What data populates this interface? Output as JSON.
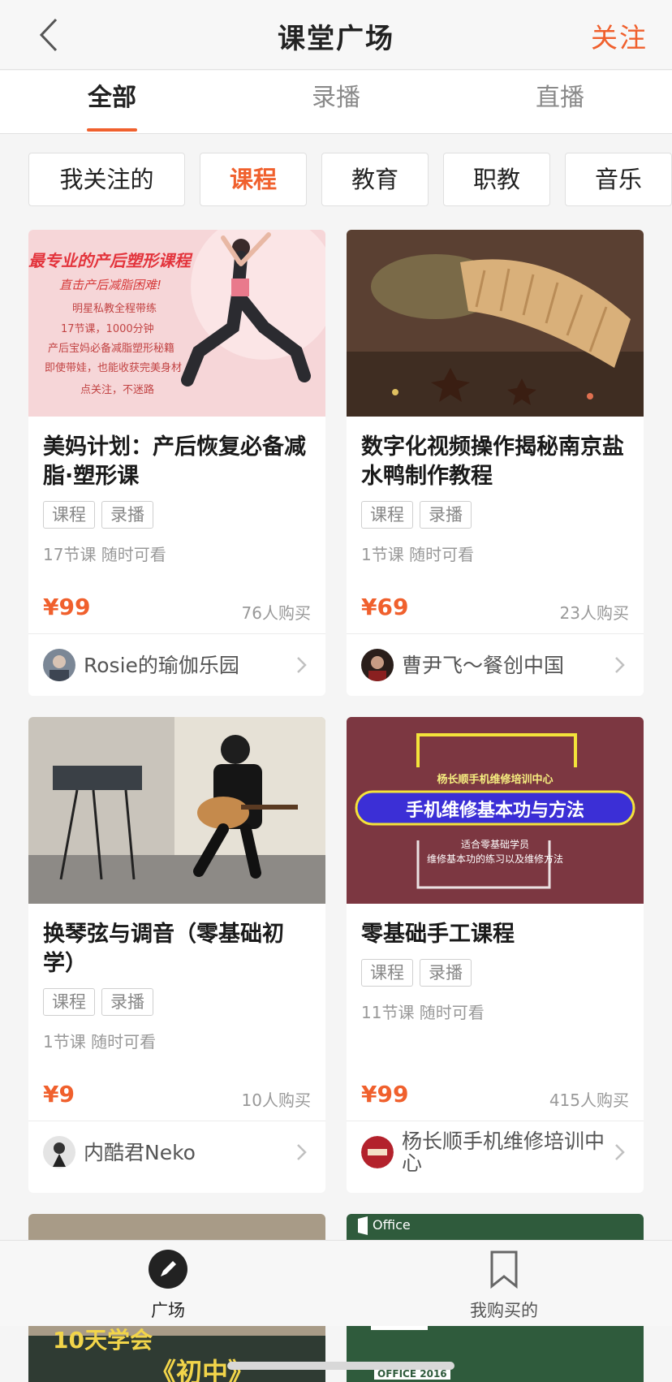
{
  "header": {
    "title": "课堂广场",
    "follow_label": "关注"
  },
  "tabs": [
    {
      "label": "全部",
      "active": true
    },
    {
      "label": "录播",
      "active": false
    },
    {
      "label": "直播",
      "active": false
    }
  ],
  "chips": [
    {
      "label": "我关注的",
      "active": false
    },
    {
      "label": "课程",
      "active": true
    },
    {
      "label": "教育",
      "active": false
    },
    {
      "label": "职教",
      "active": false
    },
    {
      "label": "音乐",
      "active": false
    }
  ],
  "courses": [
    {
      "thumb_lines": [
        "最专业的产后塑形课程",
        "直击产后减脂困难!",
        "明星私教全程带练",
        "17节课，1000分钟",
        "产后宝妈必备减脂塑形秘籍",
        "即使带娃，也能收获完美身材",
        "点关注，不迷路"
      ],
      "title": "美妈计划：产后恢复必备减脂·塑形课",
      "tags": [
        "课程",
        "录播"
      ],
      "meta": "17节课  随时可看",
      "price": "¥99",
      "buyers": "76人购买",
      "author": "Rosie的瑜伽乐园"
    },
    {
      "thumb_lines": [],
      "title": "数字化视频操作揭秘南京盐水鸭制作教程",
      "tags": [
        "课程",
        "录播"
      ],
      "meta": "1节课  随时可看",
      "price": "¥69",
      "buyers": "23人购买",
      "author": "曹尹飞～餐创中国"
    },
    {
      "thumb_lines": [],
      "title": "换琴弦与调音（零基础初学）",
      "tags": [
        "课程",
        "录播"
      ],
      "meta": "1节课  随时可看",
      "price": "¥9",
      "buyers": "10人购买",
      "author": "内酷君Neko"
    },
    {
      "thumb_lines": [
        "杨长顺手机维修培训中心",
        "手机维修基本功与方法",
        "适合零基础学员",
        "维修基本功的练习以及维修方法"
      ],
      "title": "零基础手工课程",
      "tags": [
        "课程",
        "录播"
      ],
      "meta": "11节课  随时可看",
      "price": "¥99",
      "buyers": "415人购买",
      "author": "杨长顺手机维修培训中心"
    }
  ],
  "peek_cards": [
    {
      "lines": [
        "10天学会",
        "《初中》"
      ]
    },
    {
      "lines": [
        "Office",
        "OFFICE 2016"
      ]
    }
  ],
  "bottom_nav": [
    {
      "label": "广场",
      "icon": "pen-circle-icon",
      "active": true
    },
    {
      "label": "我购买的",
      "icon": "bookmark-icon",
      "active": false
    }
  ],
  "colors": {
    "accent": "#f0602d",
    "text": "#222222",
    "muted": "#999999"
  }
}
